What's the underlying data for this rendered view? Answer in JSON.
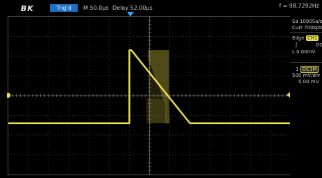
{
  "header": {
    "brand": "BK",
    "trigger_status": "Trig'd",
    "timebase": "M 50.0μs",
    "delay": "Delay 52.00μs",
    "frequency": "f = 98.7292Hz"
  },
  "sidebar": {
    "sample_rate": "Sa 1000Sa/s",
    "memory_depth": "Curr 700kpts",
    "trigger_type": "Edge",
    "trigger_source": "CH1",
    "trigger_slope": "ʃ",
    "trigger_coupling": "DC",
    "trigger_level": "L 0.00mV",
    "channel_number": "1",
    "channel_coupling": "DC1M",
    "channel_scale": "500 mV/div",
    "channel_offset": "0.00 mV"
  },
  "colors": {
    "trace": "#e8e04b",
    "trigger_marker": "#2ea8ff",
    "grid": "#3a3a3a"
  },
  "waveform": {
    "low_level_div": -1.4,
    "high_level_div": 2.3,
    "rise_time_div": 3.15,
    "fall_start_time_div": 3.3,
    "fall_end_time_div": 7.05
  }
}
